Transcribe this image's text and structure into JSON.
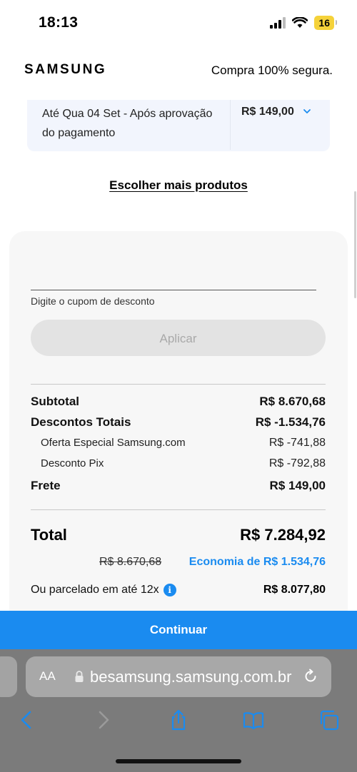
{
  "status_bar": {
    "time": "18:13",
    "battery": "16"
  },
  "header": {
    "logo": "SAMSUNG",
    "secure_text": "Compra 100% segura."
  },
  "delivery": {
    "description": "Até Qua 04 Set - Após aprovação do pagamento",
    "price": "R$ 149,00"
  },
  "more_products_link": "Escolher mais produtos",
  "coupon": {
    "label": "Digite o cupom de desconto",
    "apply_label": "Aplicar"
  },
  "summary": {
    "subtotal_label": "Subtotal",
    "subtotal_value": "R$ 8.670,68",
    "discounts_label": "Descontos Totais",
    "discounts_value": "R$ -1.534,76",
    "offer_label": "Oferta Especial Samsung.com",
    "offer_value": "R$ -741,88",
    "pix_label": "Desconto Pix",
    "pix_value": "R$ -792,88",
    "shipping_label": "Frete",
    "shipping_value": "R$ 149,00",
    "total_label": "Total",
    "total_value": "R$ 7.284,92",
    "old_price": "R$ 8.670,68",
    "economy": "Economia de R$ 1.534,76",
    "installment_label": "Ou parcelado em até 12x",
    "installment_value": "R$ 8.077,80"
  },
  "continue_label": "Continuar",
  "browser": {
    "aa_label": "AA",
    "url": "besamsung.samsung.com.br"
  },
  "colors": {
    "accent": "#1a8bf0",
    "panel": "#f7f7f7",
    "delivery_bg": "#f2f5fd",
    "browser_bg": "#7b7b7b"
  }
}
